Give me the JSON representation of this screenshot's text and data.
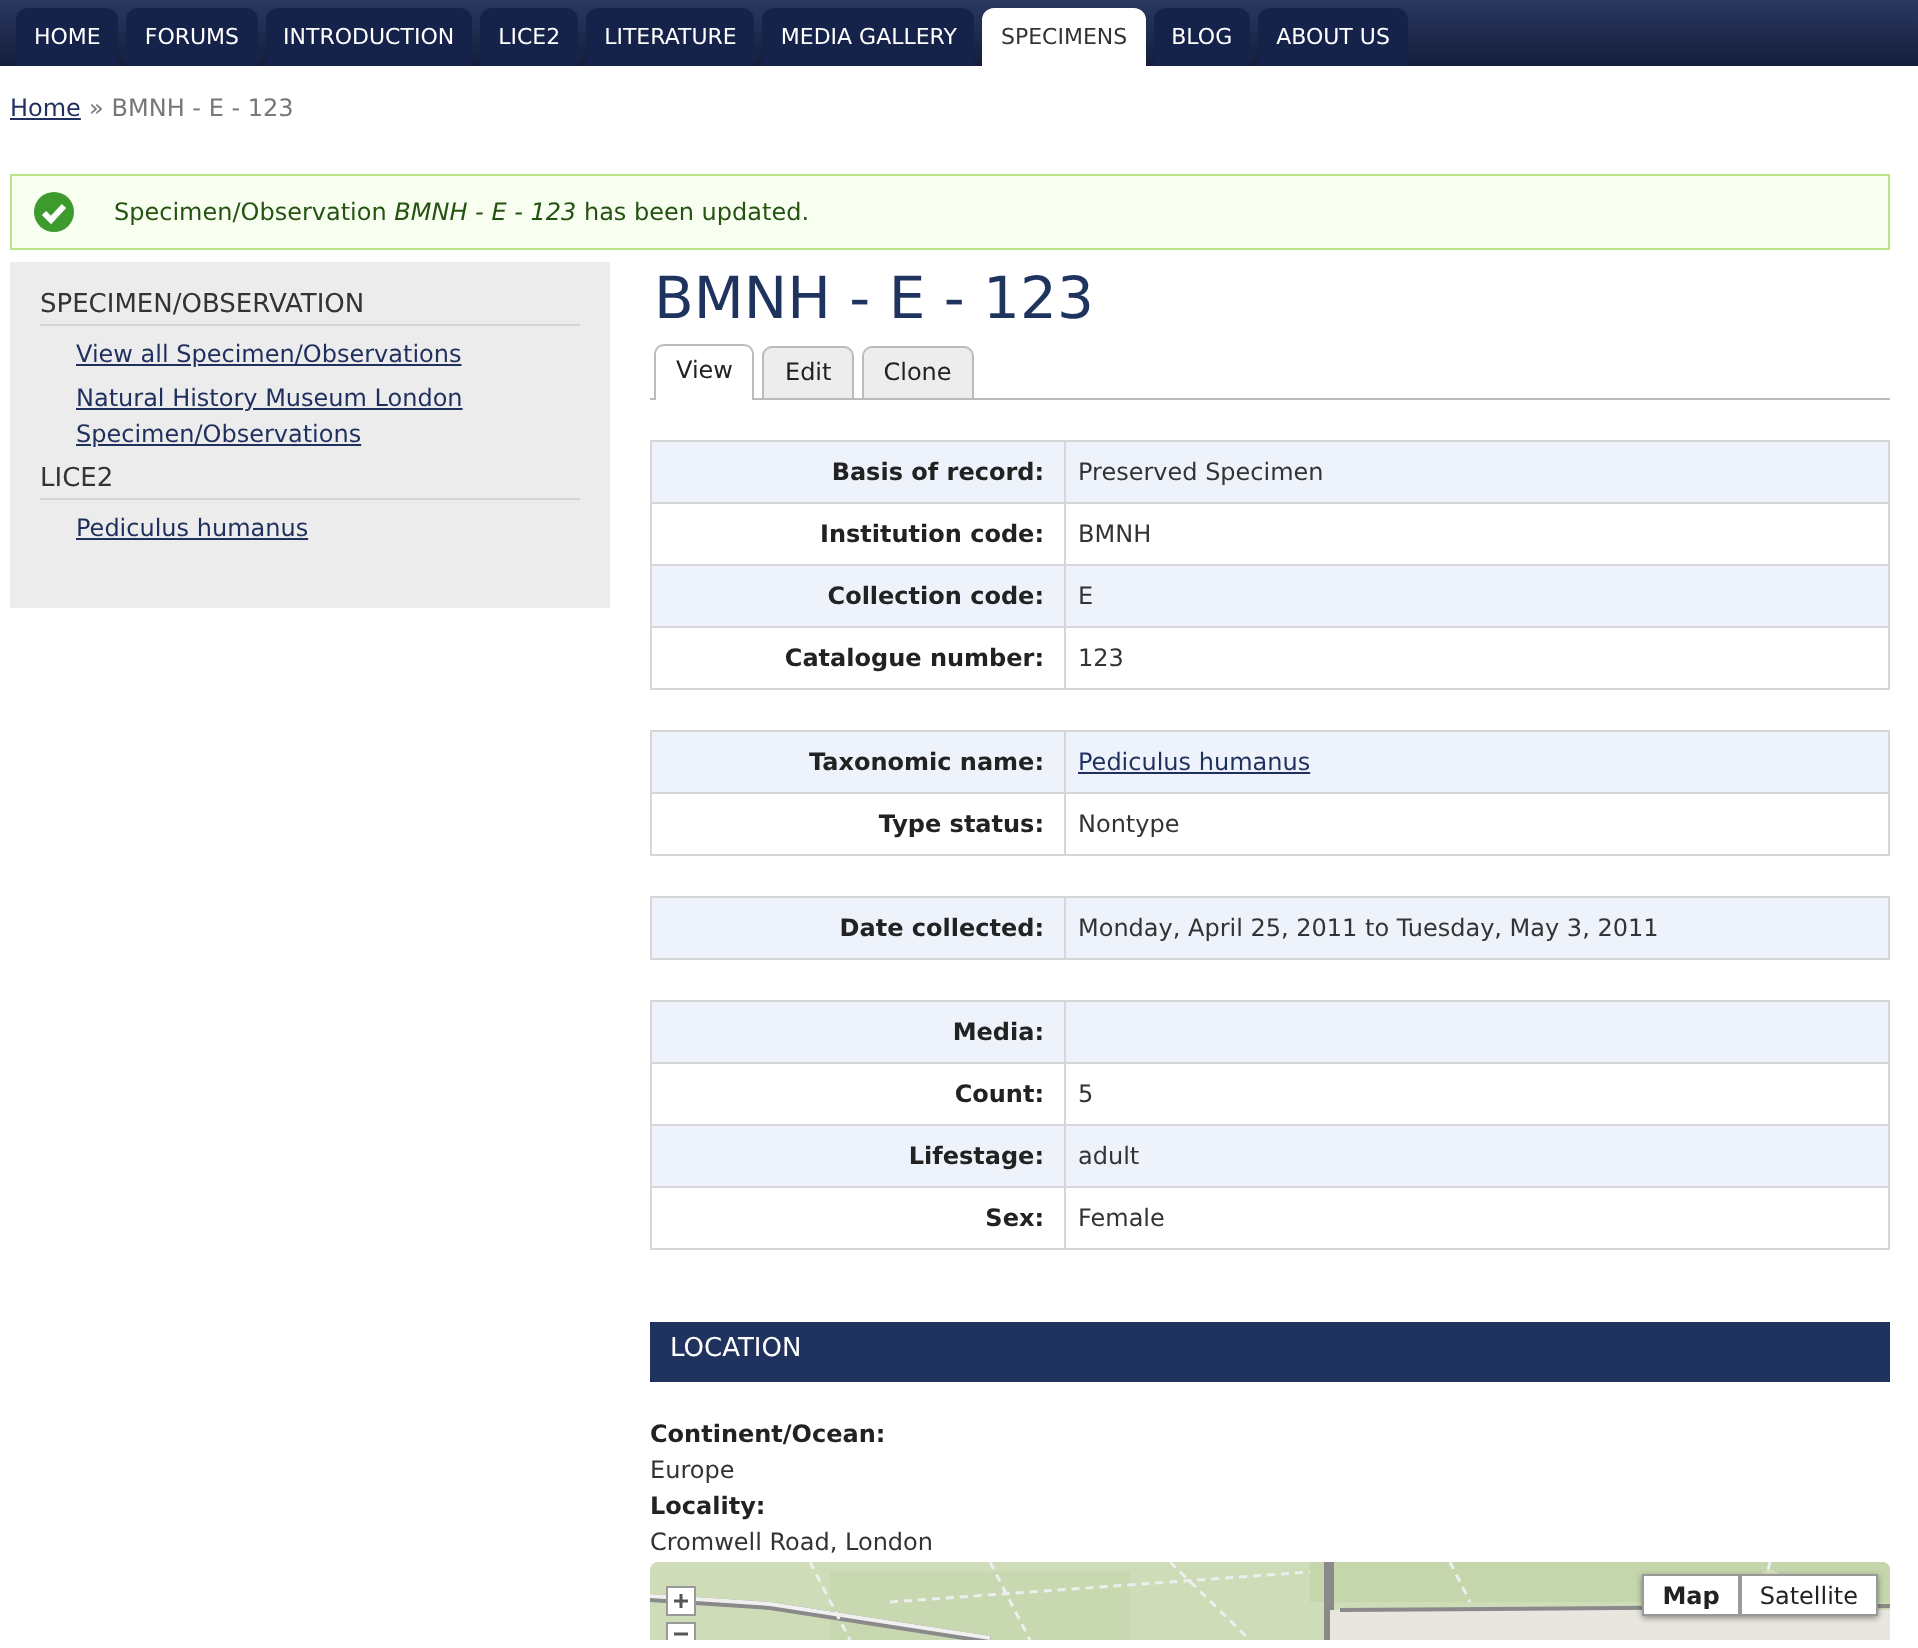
{
  "nav_tabs": [
    {
      "label": "HOME",
      "selected": false
    },
    {
      "label": "FORUMS",
      "selected": false
    },
    {
      "label": "INTRODUCTION",
      "selected": false
    },
    {
      "label": "LICE2",
      "selected": false
    },
    {
      "label": "LITERATURE",
      "selected": false
    },
    {
      "label": "MEDIA GALLERY",
      "selected": false
    },
    {
      "label": "SPECIMENS",
      "selected": true
    },
    {
      "label": "BLOG",
      "selected": false
    },
    {
      "label": "ABOUT US",
      "selected": false
    }
  ],
  "breadcrumb": {
    "link": "Home",
    "separator": "»",
    "current": "BMNH - E - 123"
  },
  "message": {
    "text": "Specimen/Observation *BMNH - E - 123* has been updated."
  },
  "sidebar": {
    "sections": [
      {
        "heading": "SPECIMEN/OBSERVATION",
        "links": [
          "View all Specimen/Observations",
          "Natural History Museum London Specimen/Observations"
        ]
      },
      {
        "heading": "LICE2",
        "links": [
          "Pediculus humanus"
        ]
      }
    ]
  },
  "page_title": "BMNH - E - 123",
  "tabs": [
    {
      "label": "View",
      "selected": true
    },
    {
      "label": "Edit",
      "selected": false
    },
    {
      "label": "Clone",
      "selected": false
    }
  ],
  "tables": [
    [
      {
        "label": "Basis of record:",
        "value": "Preserved Specimen",
        "kind": "text"
      },
      {
        "label": "Institution code:",
        "value": "BMNH",
        "kind": "text"
      },
      {
        "label": "Collection code:",
        "value": "E",
        "kind": "text"
      },
      {
        "label": "Catalogue number:",
        "value": "123",
        "kind": "text"
      }
    ],
    [
      {
        "label": "Taxonomic name:",
        "value": "Pediculus humanus",
        "kind": "link"
      },
      {
        "label": "Type status:",
        "value": "Nontype",
        "kind": "text"
      }
    ],
    [
      {
        "label": "Date collected:",
        "value": "Monday, April 25, 2011 to Tuesday, May 3, 2011",
        "kind": "text"
      }
    ],
    [
      {
        "label": "Media:"
      },
      {
        "label": "Count:",
        "value": "5",
        "kind": "text"
      },
      {
        "label": "Lifestage:",
        "value": "adult",
        "kind": "text"
      },
      {
        "label": "Sex:",
        "value": "Female",
        "kind": "text"
      }
    ]
  ],
  "location": {
    "heading": "LOCATION",
    "fields": [
      {
        "label": "Continent/Ocean:",
        "value": "Europe"
      },
      {
        "label": "Locality:",
        "value": "Cromwell Road, London"
      }
    ],
    "map": {
      "kind": "picture",
      "map_types": [
        {
          "label": "Map",
          "selected": true
        },
        {
          "label": "Satellite",
          "selected": false
        }
      ]
    }
  }
}
